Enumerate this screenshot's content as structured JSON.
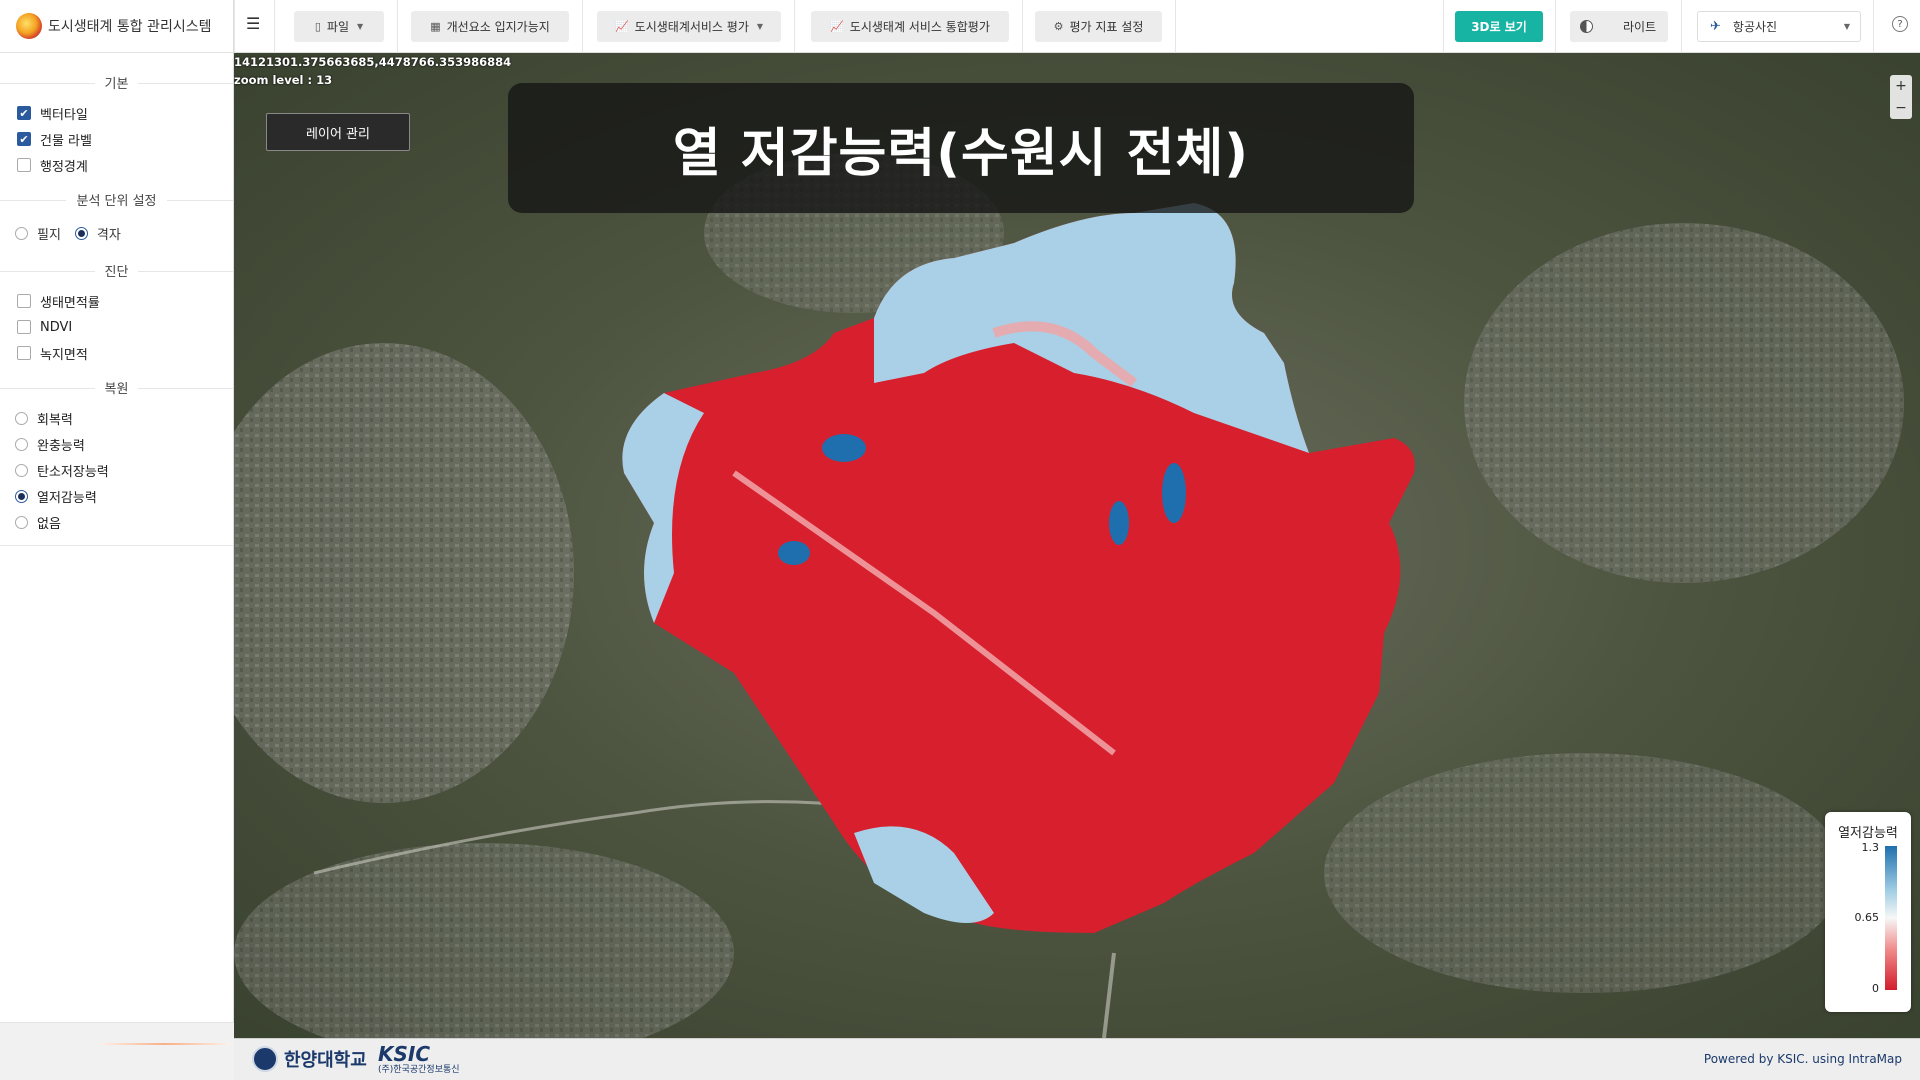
{
  "app": {
    "title": "도시생태계 통합 관리시스템"
  },
  "toolbar": {
    "file": "파일",
    "improvement": "개선요소 입지가능지",
    "service_eval": "도시생태계서비스 평가",
    "integrated_eval": "도시생태계 서비스 통합평가",
    "index_setting": "평가 지표 설정",
    "view3d": "3D로 보기",
    "theme": "라이트",
    "basemap": "항공사진"
  },
  "sidebar": {
    "section_basic": "기본",
    "basic_items": [
      {
        "label": "벡터타일",
        "checked": true
      },
      {
        "label": "건물 라벨",
        "checked": true
      },
      {
        "label": "행정경계",
        "checked": false
      }
    ],
    "section_unit": "분석 단위 설정",
    "unit_options": [
      {
        "label": "필지",
        "selected": false
      },
      {
        "label": "격자",
        "selected": true
      }
    ],
    "section_diagnosis": "진단",
    "diagnosis_items": [
      {
        "label": "생태면적률",
        "checked": false
      },
      {
        "label": "NDVI",
        "checked": false
      },
      {
        "label": "녹지면적",
        "checked": false
      }
    ],
    "section_restore": "복원",
    "restore_options": [
      {
        "label": "회복력",
        "selected": false
      },
      {
        "label": "완충능력",
        "selected": false
      },
      {
        "label": "탄소저장능력",
        "selected": false
      },
      {
        "label": "열저감능력",
        "selected": true
      },
      {
        "label": "없음",
        "selected": false
      }
    ]
  },
  "map": {
    "coordinate": "14121301.375663685,4478766.353986884",
    "zoom_level": "zoom level : 13",
    "layer_button": "레이어 관리",
    "title": "열 저감능력(수원시 전체)",
    "zoom_in": "+",
    "zoom_out": "−"
  },
  "legend": {
    "title": "열저감능력",
    "max": "1.3",
    "mid": "0.65",
    "min": "0",
    "colors": [
      "#1f6fae",
      "#f7f7f7",
      "#d21c2b"
    ]
  },
  "footer": {
    "university": "한양대학교",
    "ksic": "KSIC",
    "ksic_sub": "(주)한국공간정보통신",
    "powered": "Powered by KSIC. using IntraMap"
  }
}
